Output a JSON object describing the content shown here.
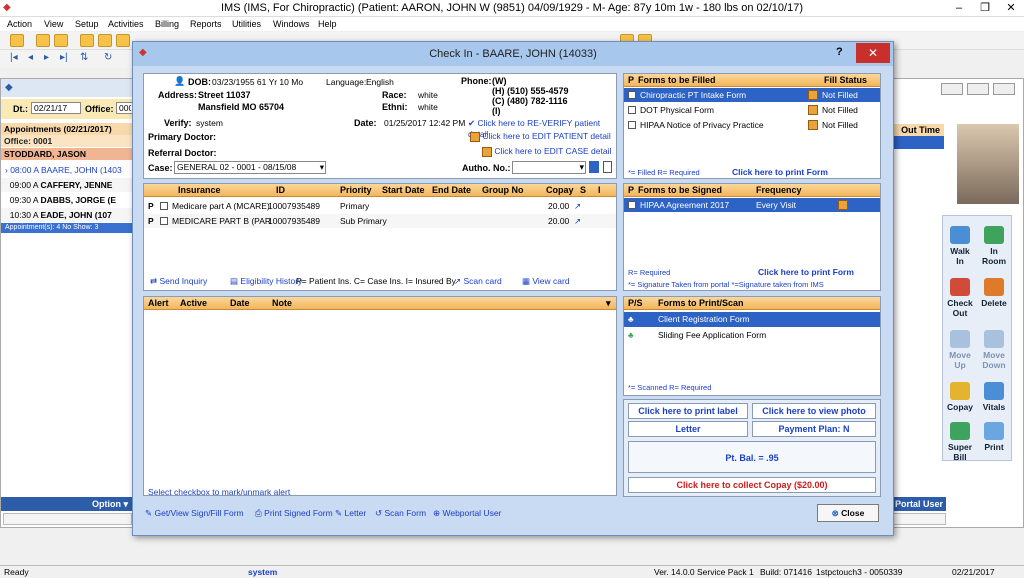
{
  "app": {
    "title": "IMS (IMS, For Chiropractic)    (Patient: AARON, JOHN W (9851) 04/09/1929 - M- Age: 87y 10m 1w - 180 lbs on 02/10/17)",
    "menu": [
      "Action",
      "View",
      "Setup",
      "Activities",
      "Billing",
      "Reports",
      "Utilities",
      "Windows",
      "Help"
    ]
  },
  "left_panel": {
    "date_label": "Dt.:",
    "date_value": "02/21/17",
    "office_label": "Office:",
    "office_value": "0001",
    "appointments_header": "Appointments (02/21/2017)",
    "office_row": "Office: 0001",
    "provider": "STODDARD, JASON",
    "appointments": [
      {
        "time": "08:00 A",
        "name": "BAARE, JOHN (1403"
      },
      {
        "time": "09:00 A",
        "name": "CAFFERY, JENNE"
      },
      {
        "time": "09:30 A",
        "name": "DABBS, JORGE (E"
      },
      {
        "time": "10:30 A",
        "name": "EADE, JOHN (107"
      }
    ],
    "summary": "Appointment(s): 4  No Show: 3",
    "option_label": "Option"
  },
  "right_panel": {
    "time_out_label": "Out Time",
    "portal_user": "Portal User",
    "buttons": [
      {
        "label1": "Walk",
        "label2": "In"
      },
      {
        "label1": "In",
        "label2": "Room"
      },
      {
        "label1": "Check",
        "label2": "Out"
      },
      {
        "label1": "Delete",
        "label2": ""
      },
      {
        "label1": "Move",
        "label2": "Up"
      },
      {
        "label1": "Move",
        "label2": "Down"
      },
      {
        "label1": "Copay",
        "label2": ""
      },
      {
        "label1": "Vitals",
        "label2": ""
      },
      {
        "label1": "Super",
        "label2": "Bill"
      },
      {
        "label1": "Print",
        "label2": ""
      }
    ]
  },
  "dialog": {
    "title": "Check In - BAARE, JOHN  (14033)",
    "help": "?",
    "close_x": "✕",
    "patient": {
      "dob_label": "DOB:",
      "dob": "03/23/1955 61 Yr 10 Mo",
      "language_label": "Language:",
      "language": "English",
      "phone_label": "Phone:",
      "phone_w": "(W)",
      "phone_h": "(H)  (510) 555-4579",
      "phone_c": "(C)  (480) 782-1116",
      "phone_i": "(I)",
      "address_label": "Address:",
      "address1": "Street 11037",
      "address2": "Mansfield  MO  65704",
      "race_label": "Race:",
      "race": "white",
      "ethni_label": "Ethni:",
      "ethni": "white",
      "verify_label": "Verify:",
      "verify": "system",
      "date_label": "Date:",
      "date": "01/25/2017 12:42 PM",
      "reverify_link": "Click here to RE-VERIFY patient detail",
      "edit_patient_link": "Click here to EDIT PATIENT detail",
      "edit_case_link": "Click here to EDIT CASE detail",
      "primary_doctor_label": "Primary Doctor:",
      "referral_doctor_label": "Referral Doctor:",
      "case_label": "Case:",
      "case_value": "GENERAL 02  -  0001 - 08/15/08",
      "autho_label": "Autho. No.:"
    },
    "insurance": {
      "columns": [
        "Insurance",
        "ID",
        "Priority",
        "Start Date",
        "End Date",
        "Group No",
        "Copay",
        "S",
        "I"
      ],
      "rows": [
        {
          "flag": "P",
          "insurance": "Medicare part A  (MCARE)",
          "id": "10007935489",
          "priority": "Primary",
          "copay": "20.00"
        },
        {
          "flag": "P",
          "insurance": "MEDICARE PART B  (PAR",
          "id": "10007935489",
          "priority": "Sub Primary",
          "copay": "20.00"
        }
      ],
      "footer": {
        "send_inquiry": "Send Inquiry",
        "eligibility": "Eligibility History",
        "legend": "P= Patient Ins. C= Case Ins. I= Insured By",
        "scan_card": "Scan card",
        "view_card": "View card"
      }
    },
    "alerts": {
      "columns": [
        "Alert",
        "Active",
        "Date",
        "Note"
      ],
      "footer": "Select checkbox to mark/unmark alert"
    },
    "forms_filled": {
      "col_p": "P",
      "col_forms": "Forms to be Filled",
      "col_status": "Fill Status",
      "rows": [
        {
          "name": "Chiropractic PT Intake Form",
          "status": "Not Filled"
        },
        {
          "name": "DOT Physical Form",
          "status": "Not Filled"
        },
        {
          "name": "HIPAA Notice of Privacy Practice",
          "status": "Not Filled"
        }
      ],
      "legend": "*= Filled  R= Required",
      "print_link": "Click here to print Form"
    },
    "forms_signed": {
      "col_p": "P",
      "col_forms": "Forms to be Signed",
      "col_freq": "Frequency",
      "rows": [
        {
          "name": "HIPAA Agreement 2017",
          "freq": "Every Visit"
        }
      ],
      "legend": "R= Required",
      "legend2": "*= Signature Taken from portal  *=Signature taken from IMS",
      "print_link": "Click here to print Form"
    },
    "forms_print": {
      "col_ps": "P/S",
      "col_forms": "Forms to Print/Scan",
      "rows": [
        "Client Registration Form",
        "Sliding Fee Application Form"
      ],
      "legend": "*= Scanned   R= Required"
    },
    "actions": {
      "print_label": "Click here to print label",
      "view_photo": "Click here to view photo",
      "letter": "Letter",
      "payment_plan": "Payment Plan: N",
      "pt_bal": "Pt. Bal. = .95",
      "collect_copay": "Click here to collect Copay ($20.00)"
    },
    "bottom": {
      "get_view_sign": "Get/View Sign/Fill Form",
      "print_signed": "Print Signed Form",
      "letter": "Letter",
      "scan_form": "Scan Form",
      "webportal": "Webportal User",
      "close": "Close"
    }
  },
  "statusbar": {
    "ready": "Ready",
    "user": "system",
    "version": "Ver. 14.0.0 Service Pack 1",
    "build": "Build: 071416",
    "station": "1stpctouch3 - 0050339",
    "date": "02/21/2017"
  }
}
